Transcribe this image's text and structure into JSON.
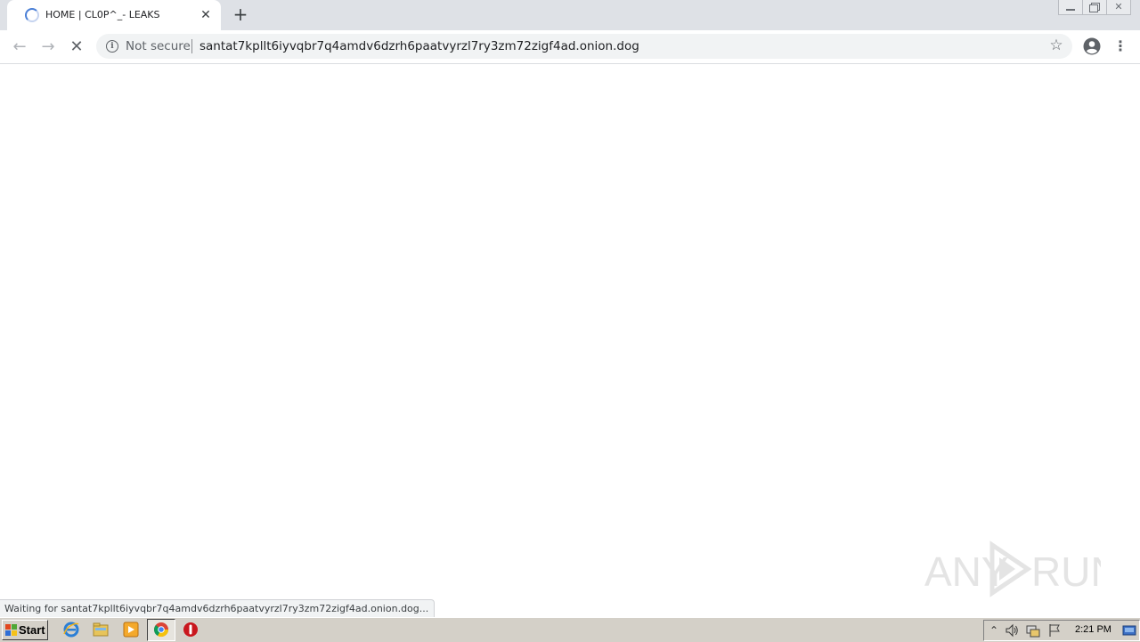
{
  "browser": {
    "tab": {
      "title": "HOME | CL0P^_- LEAKS",
      "close_glyph": "✕"
    },
    "new_tab_glyph": "+",
    "window_controls": {
      "close_glyph": "✕"
    },
    "toolbar": {
      "back_glyph": "←",
      "forward_glyph": "→",
      "stop_glyph": "✕",
      "security_label": "Not secure",
      "url": "santat7kpllt6iyvqbr7q4amdv6dzrh6paatvyrzl7ry3zm72zigf4ad.onion.dog",
      "star_glyph": "☆",
      "menu_glyph": "⋮"
    },
    "status_text": "Waiting for santat7kpllt6iyvqbr7q4amdv6dzrh6paatvyrzl7ry3zm72zigf4ad.onion.dog...",
    "accent_color": "#4a7fd6"
  },
  "watermark": {
    "text_left": "ANY",
    "text_right": "RUN"
  },
  "taskbar": {
    "start_label": "Start",
    "pinned_icons": [
      "internet-explorer-icon",
      "windows-explorer-icon",
      "media-player-icon",
      "chrome-icon",
      "stop-sign-icon"
    ],
    "tray_icons": [
      "show-hidden-icon",
      "volume-icon",
      "network-icon",
      "action-center-flag-icon",
      "show-desktop-icon"
    ],
    "clock": "2:21 PM"
  }
}
